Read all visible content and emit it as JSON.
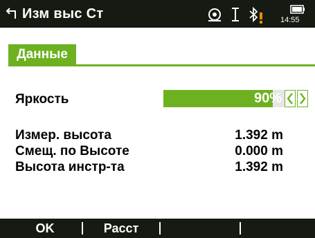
{
  "header": {
    "title": "Изм выс Ст",
    "time": "14:55",
    "icons": [
      "back-arrow-icon",
      "target-icon",
      "cursor-i-icon",
      "bluetooth-icon",
      "warning-icon",
      "battery-icon"
    ],
    "accent_color": "#6db120"
  },
  "tabs": [
    {
      "label": "Данные",
      "active": true
    }
  ],
  "fields": {
    "brightness": {
      "label": "Яркость",
      "value": "90%",
      "level_percent": 90
    },
    "measured_height": {
      "label": "Измер. высота",
      "value": "1.392 m"
    },
    "height_offset": {
      "label": "Смещ. по Высоте",
      "value": "0.000 m"
    },
    "instrument_height": {
      "label": "Высота инстр-та",
      "value": "1.392 m"
    }
  },
  "softkeys": [
    {
      "label": "OK"
    },
    {
      "label": "Расст"
    },
    {
      "label": ""
    },
    {
      "label": ""
    }
  ]
}
